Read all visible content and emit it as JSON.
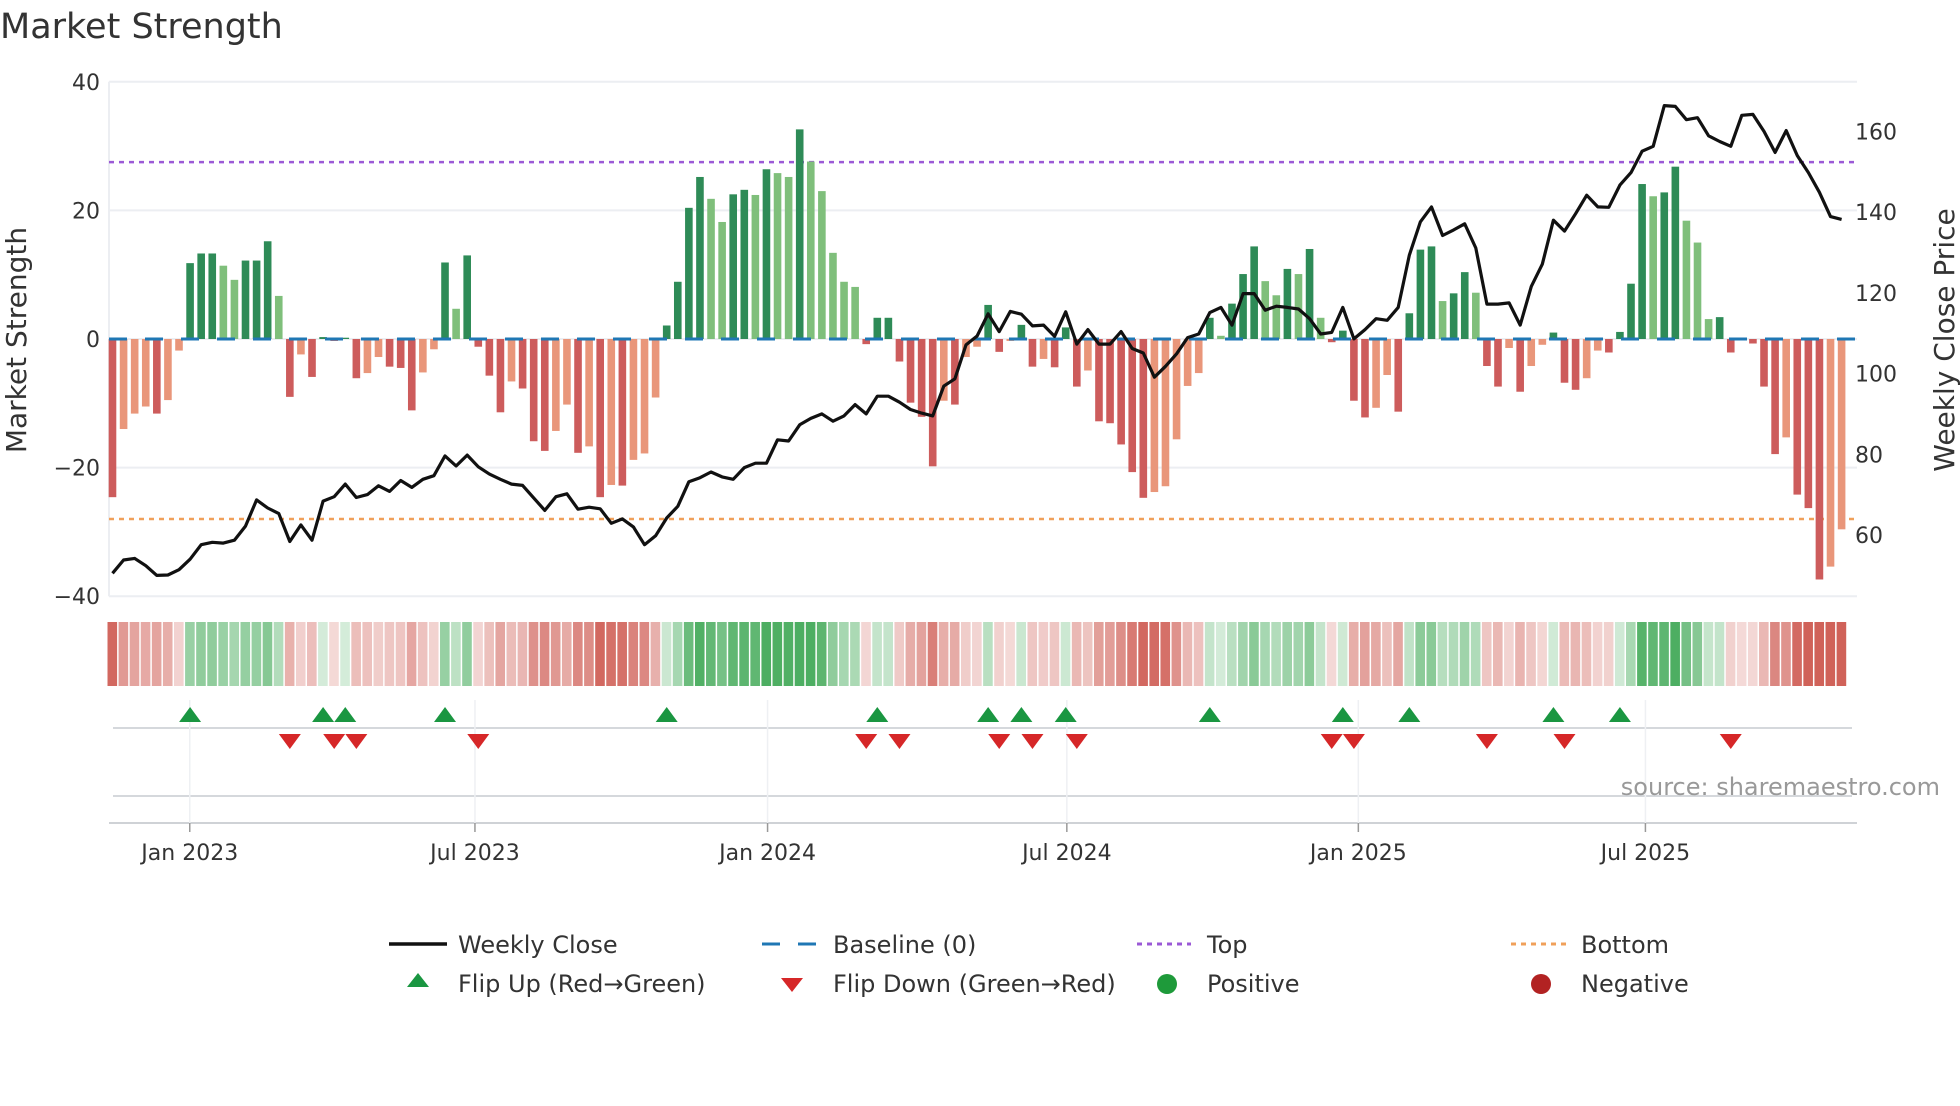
{
  "chart_data": {
    "type": "bar",
    "title": "Market Strength",
    "ylabel": "Market Strength",
    "y2label": "Weekly Close Price",
    "ylim": [
      -40,
      40
    ],
    "y2lim": [
      47.5,
      172.5
    ],
    "yticks": [
      "40",
      "20",
      "0",
      "−20",
      "−40"
    ],
    "ytick_values": [
      40,
      20,
      0,
      -20,
      -40
    ],
    "y2ticks": [
      "160",
      "140",
      "120",
      "100",
      "80",
      "60"
    ],
    "y2tick_values": [
      160,
      140,
      120,
      100,
      80,
      60
    ],
    "top_level": 27.5,
    "bottom_level": -28,
    "xticks": [
      {
        "label": "Jan 2023",
        "week": 6.97
      },
      {
        "label": "Jul 2023",
        "week": 32.7
      },
      {
        "label": "Jan 2024",
        "week": 59.1
      },
      {
        "label": "Jul 2024",
        "week": 86.1
      },
      {
        "label": "Jan 2025",
        "week": 112.4
      },
      {
        "label": "Jul 2025",
        "week": 138.3
      }
    ],
    "strength": [
      -24.6,
      -14,
      -11.6,
      -10.5,
      -11.6,
      -9.5,
      -1.8,
      11.8,
      13.3,
      13.3,
      11.4,
      9.2,
      12.2,
      12.2,
      15.2,
      6.7,
      -9,
      -2.4,
      -5.9,
      0.3,
      -0.3,
      0.2,
      -6.1,
      -5.3,
      -2.8,
      -4.3,
      -4.5,
      -11.1,
      -5.2,
      -1.6,
      11.9,
      4.7,
      13,
      -1.2,
      -5.7,
      -11.4,
      -6.6,
      -7.7,
      -15.9,
      -17.4,
      -14.3,
      -10.2,
      -17.7,
      -16.7,
      -24.6,
      -22.7,
      -22.8,
      -18.8,
      -17.8,
      -9.1,
      2.1,
      8.9,
      20.4,
      25.2,
      21.8,
      18.2,
      22.5,
      23.2,
      22.4,
      26.4,
      25.8,
      25.2,
      32.6,
      27.6,
      23,
      13.4,
      8.9,
      8.1,
      -0.8,
      3.3,
      3.3,
      -3.5,
      -9.9,
      -12.1,
      -19.8,
      -9.6,
      -10.2,
      -2.8,
      -1.2,
      5.3,
      -2,
      -0.3,
      2.2,
      -4.3,
      -3.1,
      -4.4,
      1.8,
      -7.4,
      -4.9,
      -12.8,
      -13.1,
      -16.4,
      -20.7,
      -24.7,
      -23.8,
      -22.9,
      -15.6,
      -7.3,
      -5.3,
      3.3,
      0.5,
      5.5,
      10.1,
      14.4,
      9,
      6.8,
      10.9,
      10.1,
      14,
      3.3,
      -0.5,
      1.3,
      -9.6,
      -12.2,
      -10.7,
      -5.6,
      -11.3,
      4,
      13.9,
      14.4,
      5.9,
      7.1,
      10.4,
      7.2,
      -4.2,
      -7.4,
      -1.4,
      -8.2,
      -4.2,
      -0.9,
      1,
      -6.8,
      -7.9,
      -6.1,
      -1.8,
      -2.1,
      1.1,
      8.6,
      24.1,
      22.2,
      22.8,
      26.8,
      18.4,
      15,
      3.1,
      3.4,
      -2.1,
      -0.2,
      -0.7,
      -7.4,
      -17.9,
      -15.3,
      -24.2,
      -26.3,
      -37.4,
      -35.4,
      -29.6
    ],
    "weekly_close": [
      50.5,
      53.8,
      54.2,
      52.4,
      50,
      50.1,
      51.4,
      54,
      57.6,
      58.2,
      58,
      58.7,
      62.2,
      68.7,
      66.7,
      65.3,
      58.4,
      62.5,
      58.7,
      68.4,
      69.5,
      72.6,
      69.3,
      70,
      72.2,
      70.8,
      73.5,
      71.8,
      73.8,
      74.7,
      79.6,
      77.1,
      79.8,
      76.9,
      75.1,
      73.8,
      72.6,
      72.3,
      69.2,
      66.1,
      69.5,
      70.2,
      66.4,
      66.9,
      66.5,
      62.9,
      64,
      62,
      57.6,
      59.8,
      64.2,
      67.1,
      73.2,
      74.2,
      75.6,
      74.4,
      73.8,
      76.7,
      77.8,
      77.8,
      83.6,
      83.3,
      87.3,
      88.9,
      90,
      88.2,
      89.5,
      92.3,
      90,
      94.4,
      94.4,
      92.9,
      91.1,
      90.2,
      89.5,
      96.9,
      98.7,
      107.1,
      109.3,
      114.8,
      110.4,
      115.4,
      114.7,
      111.8,
      112,
      109.2,
      115.3,
      107.3,
      110.9,
      107.3,
      107.3,
      110.4,
      106.2,
      105.1,
      99.1,
      101.8,
      104.9,
      108.9,
      109.8,
      115.1,
      116.4,
      112,
      119.8,
      119.8,
      115.7,
      116.7,
      116.4,
      116,
      113.6,
      109.8,
      110.2,
      116.4,
      108.6,
      110.9,
      113.6,
      113.2,
      116.4,
      129.3,
      137.6,
      141.3,
      134.2,
      135.6,
      137.1,
      131.1,
      117.2,
      117.2,
      117.5,
      112,
      121.6,
      127.1,
      138,
      135.3,
      139.6,
      144.2,
      141.3,
      141.2,
      146.7,
      149.8,
      155.1,
      156.3,
      166.4,
      166.2,
      162.9,
      163.4,
      158.9,
      157.5,
      156.3,
      164,
      164.2,
      160,
      154.8,
      160.2,
      154,
      149.8,
      144.9,
      138.9,
      138.2
    ],
    "flip_up_weeks": [
      7,
      19,
      21,
      30,
      50,
      69,
      79,
      82,
      86,
      99,
      111,
      117,
      130,
      136
    ],
    "flip_down_weeks": [
      16,
      20,
      22,
      33,
      68,
      71,
      80,
      83,
      87,
      110,
      112,
      124,
      131,
      146
    ],
    "legend": {
      "placement": "bottom",
      "items": [
        "Weekly Close",
        "Baseline (0)",
        "Top",
        "Bottom",
        "Flip Up (Red→Green)",
        "Flip Down (Green→Red)",
        "Positive",
        "Negative"
      ]
    },
    "source": "source: sharemaestro.com"
  },
  "colors": {
    "pos_strong": "#2e8b57",
    "pos_weak": "#7fbf7b",
    "neg_strong": "#cd5c5c",
    "neg_weak": "#e9967a",
    "line": "#111111",
    "baseline": "#1f77b4",
    "top": "#9b59d6",
    "bottom": "#f0a05a",
    "flip_up": "#1a9641",
    "flip_down": "#d62728",
    "positive_dot": "#1e9a3a",
    "negative_dot": "#b22222"
  }
}
